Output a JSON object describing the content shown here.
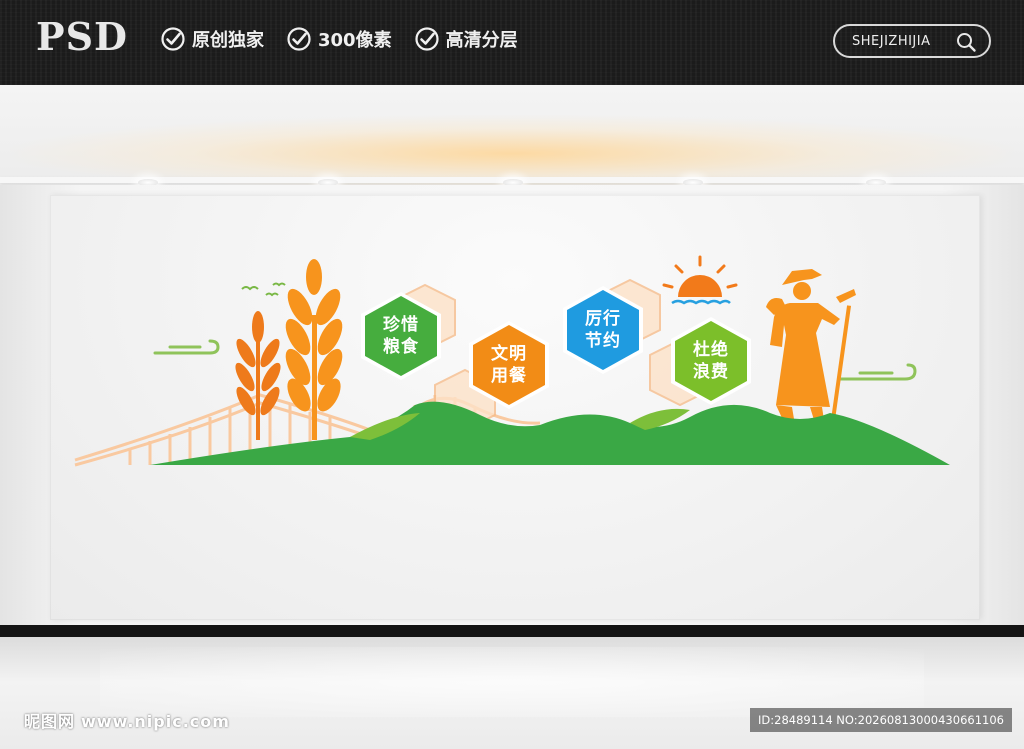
{
  "header": {
    "logo": "PSD",
    "features": [
      "原创独家",
      "300像素",
      "高清分层"
    ],
    "search_label": "SHEJIZHIJIA",
    "search_icon": "magnifier-icon",
    "check_icon": "check-circle-icon"
  },
  "wall": {
    "slogans": [
      {
        "line1": "珍惜",
        "line2": "粮食",
        "color": "#46ad3e"
      },
      {
        "line1": "文明",
        "line2": "用餐",
        "color": "#f28c16"
      },
      {
        "line1": "厉行",
        "line2": "节约",
        "color": "#1f9be0"
      },
      {
        "line1": "杜绝",
        "line2": "浪费",
        "color": "#7cbf2a"
      }
    ],
    "colors": {
      "orange": "#f7941d",
      "green": "#3aa845",
      "peach": "#f9c9a0"
    }
  },
  "watermark": {
    "site": "昵图网",
    "domain": "www.nipic.com",
    "id_text": "ID:28489114 NO:20260813000430661106"
  }
}
